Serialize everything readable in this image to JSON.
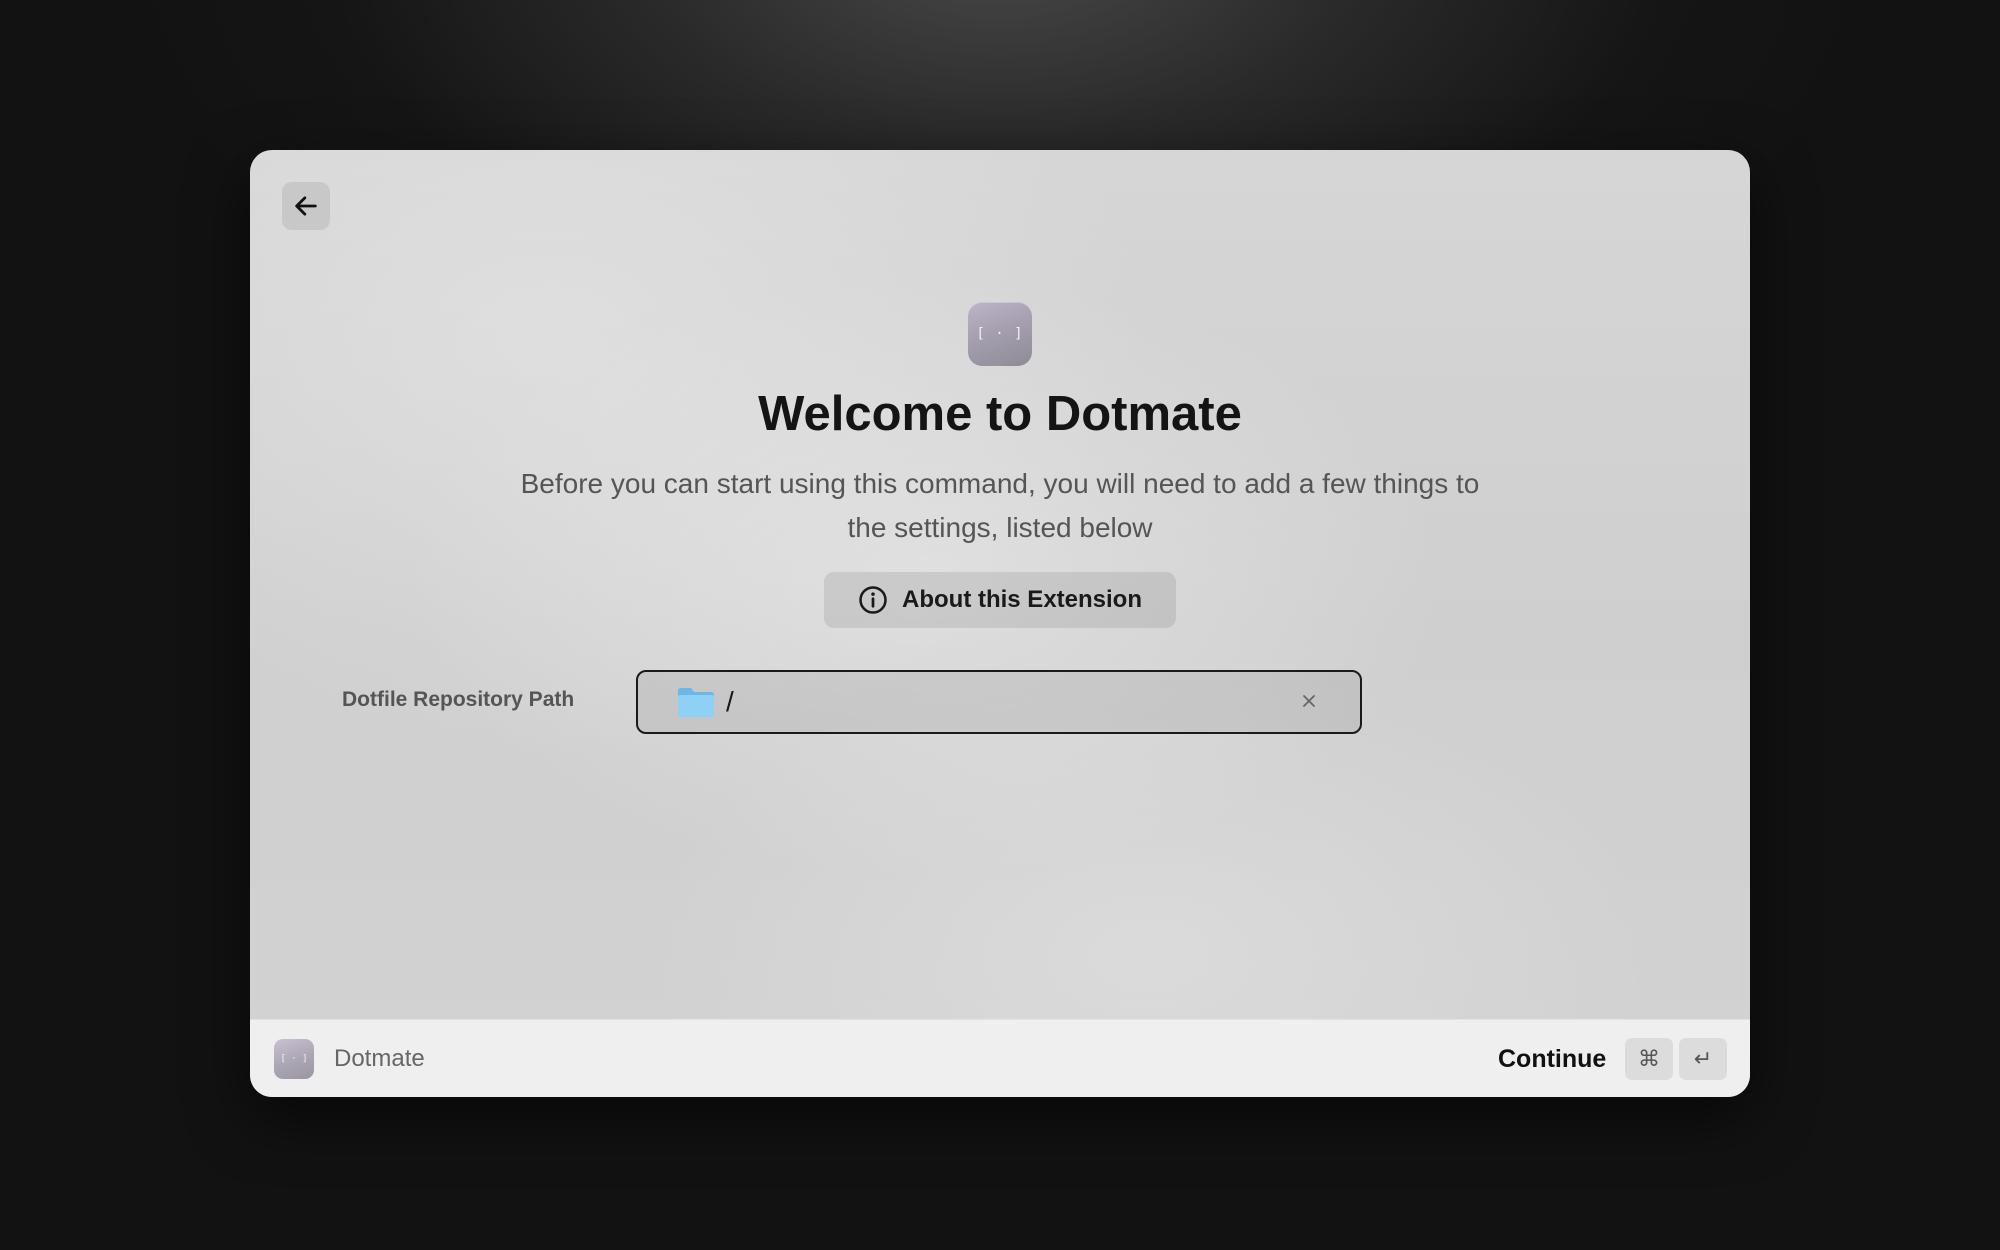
{
  "header": {
    "back_icon": "arrow-left-icon"
  },
  "main": {
    "app_icon_glyph": "[ · ]",
    "title": "Welcome to Dotmate",
    "subtitle": "Before you can start using this command, you will need to add a few things to the settings, listed below",
    "about_button": {
      "label": "About this Extension",
      "icon": "info-circle-icon"
    }
  },
  "form": {
    "field_label": "Dotfile Repository Path",
    "field_value": "/",
    "field_icon": "folder-icon",
    "clear_icon": "close-icon"
  },
  "footer": {
    "app_icon_glyph": "[ · ]",
    "app_name": "Dotmate",
    "action_label": "Continue",
    "shortcut_keys": [
      "⌘",
      "↵"
    ]
  },
  "colors": {
    "folder_blue": "#7cc6f2",
    "title_text": "#141414",
    "subtitle_text": "#555555"
  }
}
